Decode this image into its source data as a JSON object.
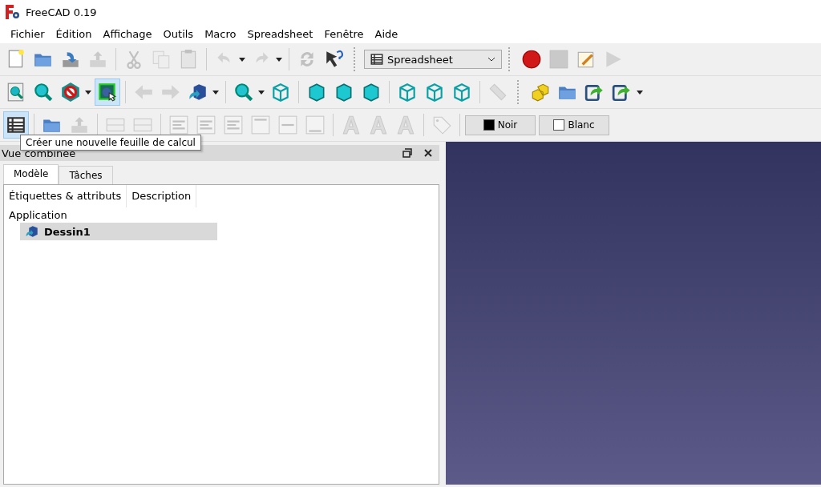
{
  "window": {
    "title": "FreeCAD 0.19"
  },
  "menu": [
    "Fichier",
    "Édition",
    "Affichage",
    "Outils",
    "Macro",
    "Spreadsheet",
    "Fenêtre",
    "Aide"
  ],
  "toolbars": [
    {
      "items": [
        {
          "kind": "tool",
          "disabled": false,
          "highlighted": false
        },
        {
          "kind": "tool",
          "disabled": false,
          "highlighted": false
        },
        {
          "kind": "tool",
          "disabled": false,
          "highlighted": false
        },
        {
          "kind": "tool",
          "disabled": true,
          "highlighted": false
        },
        {
          "kind": "separator"
        },
        {
          "kind": "tool",
          "disabled": true,
          "highlighted": false
        },
        {
          "kind": "tool",
          "disabled": true,
          "highlighted": false
        },
        {
          "kind": "tool",
          "disabled": true,
          "highlighted": false
        },
        {
          "kind": "separator"
        },
        {
          "kind": "dropdown",
          "disabled": true,
          "highlighted": false
        },
        {
          "kind": "dropdown",
          "disabled": true,
          "highlighted": false
        },
        {
          "kind": "separator"
        },
        {
          "kind": "tool",
          "disabled": true,
          "highlighted": false
        },
        {
          "kind": "tool",
          "disabled": false,
          "highlighted": false
        },
        {
          "kind": "grip"
        },
        {
          "kind": "combo",
          "value": "Spreadsheet"
        },
        {
          "kind": "grip"
        },
        {
          "kind": "tool",
          "disabled": false,
          "highlighted": false
        },
        {
          "kind": "tool",
          "disabled": true,
          "highlighted": false
        },
        {
          "kind": "tool",
          "disabled": false,
          "highlighted": false
        },
        {
          "kind": "tool",
          "disabled": true,
          "highlighted": false
        }
      ]
    },
    {
      "items": [
        {
          "kind": "tool",
          "disabled": false,
          "highlighted": false
        },
        {
          "kind": "tool",
          "disabled": false,
          "highlighted": false
        },
        {
          "kind": "dropdown",
          "disabled": false,
          "highlighted": false
        },
        {
          "kind": "tool",
          "disabled": false,
          "highlighted": true
        },
        {
          "kind": "separator"
        },
        {
          "kind": "tool",
          "disabled": true,
          "highlighted": false
        },
        {
          "kind": "tool",
          "disabled": true,
          "highlighted": false
        },
        {
          "kind": "dropdown",
          "disabled": false,
          "highlighted": false
        },
        {
          "kind": "separator"
        },
        {
          "kind": "dropdown",
          "disabled": false,
          "highlighted": false
        },
        {
          "kind": "tool",
          "disabled": false,
          "highlighted": false
        },
        {
          "kind": "separator"
        },
        {
          "kind": "tool",
          "disabled": false,
          "highlighted": false
        },
        {
          "kind": "tool",
          "disabled": false,
          "highlighted": false
        },
        {
          "kind": "tool",
          "disabled": false,
          "highlighted": false
        },
        {
          "kind": "separator"
        },
        {
          "kind": "tool",
          "disabled": false,
          "highlighted": false
        },
        {
          "kind": "tool",
          "disabled": false,
          "highlighted": false
        },
        {
          "kind": "tool",
          "disabled": false,
          "highlighted": false
        },
        {
          "kind": "separator"
        },
        {
          "kind": "tool",
          "disabled": true,
          "highlighted": false
        },
        {
          "kind": "grip"
        },
        {
          "kind": "tool",
          "disabled": false,
          "highlighted": false
        },
        {
          "kind": "tool",
          "disabled": false,
          "highlighted": false
        },
        {
          "kind": "tool",
          "disabled": false,
          "highlighted": false
        },
        {
          "kind": "dropdown",
          "disabled": false,
          "highlighted": false
        }
      ]
    },
    {
      "items": [
        {
          "kind": "tool",
          "disabled": false,
          "highlighted": true
        },
        {
          "kind": "separator"
        },
        {
          "kind": "tool",
          "disabled": false,
          "highlighted": false
        },
        {
          "kind": "tool",
          "disabled": true,
          "highlighted": false
        },
        {
          "kind": "separator"
        },
        {
          "kind": "tool",
          "disabled": true,
          "highlighted": false
        },
        {
          "kind": "tool",
          "disabled": true,
          "highlighted": false
        },
        {
          "kind": "separator"
        },
        {
          "kind": "tool",
          "disabled": true,
          "highlighted": false
        },
        {
          "kind": "tool",
          "disabled": true,
          "highlighted": false
        },
        {
          "kind": "tool",
          "disabled": true,
          "highlighted": false
        },
        {
          "kind": "tool",
          "disabled": true,
          "highlighted": false
        },
        {
          "kind": "tool",
          "disabled": true,
          "highlighted": false
        },
        {
          "kind": "tool",
          "disabled": true,
          "highlighted": false
        },
        {
          "kind": "separator"
        },
        {
          "kind": "tool",
          "disabled": true,
          "highlighted": false
        },
        {
          "kind": "tool",
          "disabled": true,
          "highlighted": false
        },
        {
          "kind": "tool",
          "disabled": true,
          "highlighted": false
        },
        {
          "kind": "separator"
        },
        {
          "kind": "tool",
          "disabled": true,
          "highlighted": false
        },
        {
          "kind": "separator"
        },
        {
          "kind": "color",
          "label": "Noir",
          "color": "#000000"
        },
        {
          "kind": "color",
          "label": "Blanc",
          "color": "#ffffff"
        }
      ]
    }
  ],
  "tooltip": "Créer une nouvelle feuille de calcul",
  "panel": {
    "title": "Vue combinée",
    "tabs": [
      {
        "label": "Modèle",
        "selected": true
      },
      {
        "label": "Tâches",
        "selected": false
      }
    ],
    "columns": [
      "Étiquettes & attributs",
      "Description"
    ],
    "tree": [
      {
        "label": "Application",
        "selected": false,
        "children": [
          {
            "label": "Dessin1",
            "selected": true
          }
        ]
      }
    ]
  }
}
